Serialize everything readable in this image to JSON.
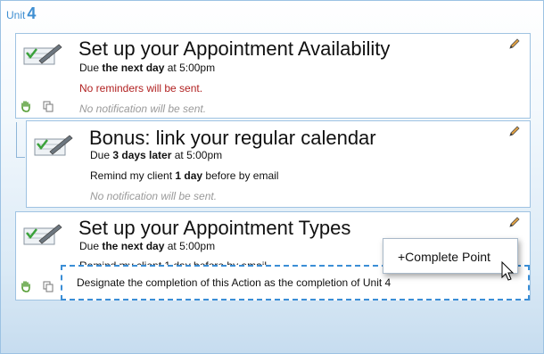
{
  "unit": {
    "prefix": "Unit",
    "number": "4"
  },
  "cards": [
    {
      "title": "Set up your Appointment Availability",
      "due_prefix": "Due",
      "due_bold": "the next day",
      "due_suffix": "at 5:00pm",
      "reminder": "No reminders will be sent.",
      "notification": "No notification will be sent."
    },
    {
      "title": "Bonus: link your regular calendar",
      "due_prefix": "Due",
      "due_bold": "3 days later",
      "due_suffix": "at 5:00pm",
      "reminder_prefix": "Remind my client",
      "reminder_bold": "1 day",
      "reminder_suffix": "before by email",
      "notification": "No notification will be sent."
    },
    {
      "title": "Set up your Appointment Types",
      "due_prefix": "Due",
      "due_bold": "the next day",
      "due_suffix": "at 5:00pm",
      "reminder_partial": "Remind my client 1 day before by email"
    }
  ],
  "completion_dropzone": {
    "text": "Designate the completion of this Action as the completion of Unit 4"
  },
  "popup": {
    "label": "+Complete Point"
  },
  "colors": {
    "accent": "#3f8fd2",
    "border": "#9fc3e2",
    "warning": "#b22222"
  },
  "icons": {
    "task": "checkmark-pen-icon",
    "edit": "pencil-icon",
    "drag": "hand-icon",
    "copy": "copy-icon",
    "cursor": "mouse-pointer-icon"
  }
}
